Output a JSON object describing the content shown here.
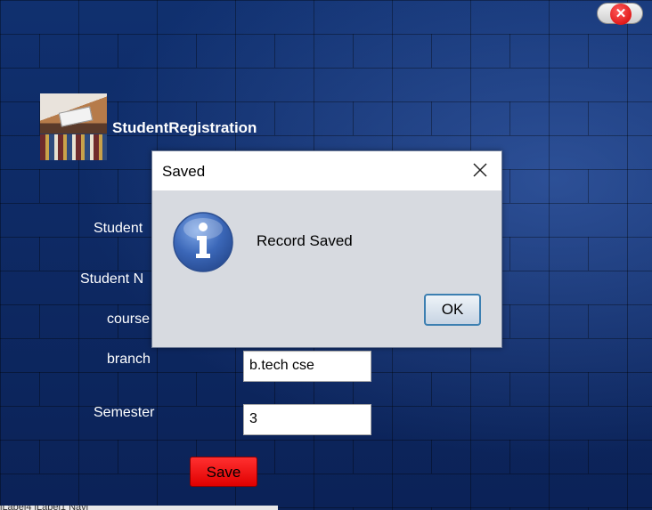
{
  "app": {
    "title": "StudentRegistration"
  },
  "form": {
    "labels": {
      "student_id": "Student",
      "student_name": "Student N",
      "course": "course",
      "branch": "branch",
      "semester": "Semester"
    },
    "fields": {
      "branch": "b.tech cse",
      "semester": "3"
    },
    "save_label": "Save"
  },
  "dialog": {
    "title": "Saved",
    "message": "Record Saved",
    "ok_label": "OK",
    "icon": "info-icon"
  },
  "bottom_strip_text": "jLabel4 jLabel1  Navi",
  "colors": {
    "background": "#0d2a63",
    "save_button": "#ff1a1a",
    "close_button": "#e00000",
    "dialog_bg": "#d7dae0"
  }
}
